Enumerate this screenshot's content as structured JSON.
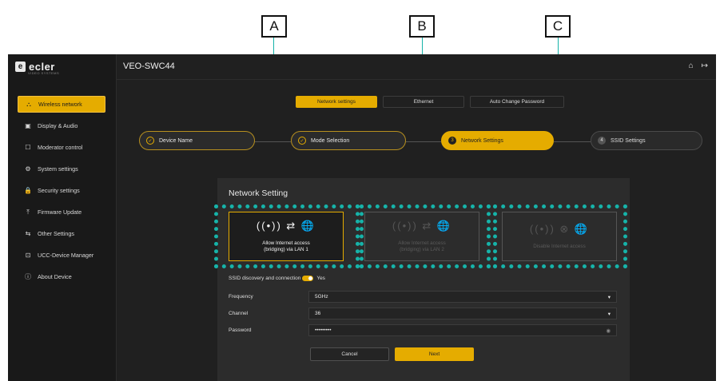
{
  "callouts": [
    {
      "letter": "A"
    },
    {
      "letter": "B"
    },
    {
      "letter": "C"
    }
  ],
  "brand": {
    "logo_text": "ecler",
    "logo_sub": "VIDEO SYSTEMS"
  },
  "sidebar": {
    "items": [
      {
        "label": "Wireless network",
        "icon": "network-icon",
        "glyph": "⛬",
        "active": true
      },
      {
        "label": "Display & Audio",
        "icon": "display-icon",
        "glyph": "▣"
      },
      {
        "label": "Moderator control",
        "icon": "moderator-icon",
        "glyph": "☐"
      },
      {
        "label": "System settings",
        "icon": "gear-icon",
        "glyph": "⚙"
      },
      {
        "label": "Security settings",
        "icon": "lock-icon",
        "glyph": "🔒"
      },
      {
        "label": "Firmware Update",
        "icon": "upload-icon",
        "glyph": "⤒"
      },
      {
        "label": "Other Settings",
        "icon": "sliders-icon",
        "glyph": "⇆"
      },
      {
        "label": "UCC-Device Manager",
        "icon": "device-manager-icon",
        "glyph": "⊡"
      },
      {
        "label": "About Device",
        "icon": "info-icon",
        "glyph": "ⓘ"
      }
    ]
  },
  "header": {
    "title": "VEO-SWC44",
    "home_glyph": "⌂",
    "logout_glyph": "↦"
  },
  "tabs": [
    {
      "label": "Network settings",
      "active": true
    },
    {
      "label": "Ethernet"
    },
    {
      "label": "Auto Change Password"
    }
  ],
  "steps": [
    {
      "label": "Device Name",
      "state": "done",
      "glyph": "✓"
    },
    {
      "label": "Mode Selection",
      "state": "done",
      "glyph": "✓"
    },
    {
      "label": "Network Settings",
      "state": "current",
      "glyph": "3"
    },
    {
      "label": "SSID Settings",
      "state": "todo",
      "glyph": "4"
    }
  ],
  "panel": {
    "title": "Network Setting",
    "options": [
      {
        "label": "Allow Internet access\n(bridging) via LAN 1",
        "icons": "((•)) ⇄ 🌐",
        "active": true
      },
      {
        "label": "Allow Internet access\n(bridging) via LAN 2",
        "icons": "((•)) ⇄ 🌐",
        "active": false
      },
      {
        "label": "Disable Internet access",
        "icons": "((•)) ⊗ 🌐",
        "active": false
      }
    ],
    "ssid_label": "SSID discovery and connection",
    "ssid_value": "Yes",
    "frequency": {
      "label": "Frequency",
      "value": "5GHz"
    },
    "channel": {
      "label": "Channel",
      "value": "36"
    },
    "password": {
      "label": "Password",
      "value": "•••••••••"
    },
    "cancel_label": "Cancel",
    "next_label": "Next"
  },
  "colors": {
    "accent": "#e5ac00",
    "highlight": "#16b3a9",
    "background": "#202020"
  }
}
